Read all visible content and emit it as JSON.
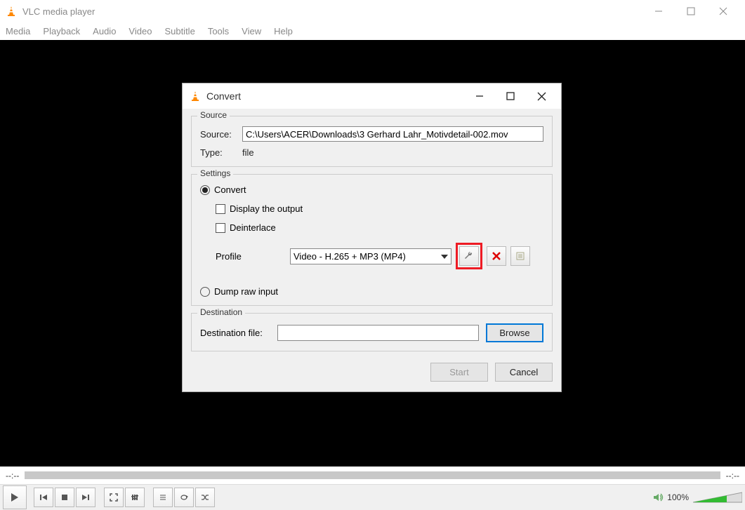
{
  "titlebar": {
    "title": "VLC media player"
  },
  "menubar": [
    "Media",
    "Playback",
    "Audio",
    "Video",
    "Subtitle",
    "Tools",
    "View",
    "Help"
  ],
  "seekbar": {
    "time_left": "--:--",
    "time_right": "--:--"
  },
  "controls": {
    "volume_pct": "100%"
  },
  "dialog": {
    "title": "Convert",
    "source_group": "Source",
    "source_label": "Source:",
    "source_value": "C:\\Users\\ACER\\Downloads\\3 Gerhard Lahr_Motivdetail-002.mov",
    "type_label": "Type:",
    "type_value": "file",
    "settings_group": "Settings",
    "convert_radio": "Convert",
    "display_output_cb": "Display the output",
    "deinterlace_cb": "Deinterlace",
    "profile_label": "Profile",
    "profile_value": "Video - H.265 + MP3 (MP4)",
    "dump_radio": "Dump raw input",
    "destination_group": "Destination",
    "destination_label": "Destination file:",
    "destination_value": "",
    "browse_btn": "Browse",
    "start_btn": "Start",
    "cancel_btn": "Cancel"
  }
}
